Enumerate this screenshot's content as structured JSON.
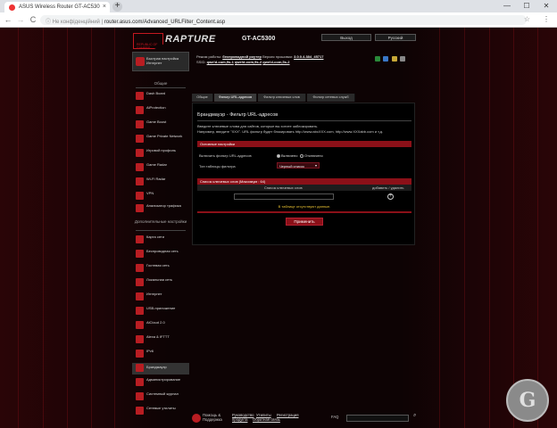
{
  "browser": {
    "tab_title": "ASUS Wireless Router GT-AC530",
    "tab_close": "×",
    "new_tab": "+",
    "win_minimize": "—",
    "win_maximize": "☐",
    "win_close": "✕",
    "back": "←",
    "forward": "→",
    "reload": "C",
    "security_label": "ⓘ Не конфіденційний",
    "separator": "|",
    "url": "router.asus.com/Advanced_URLFilter_Content.asp"
  },
  "header": {
    "brand": "RAPTURE",
    "rog_text": "REPUBLIC OF GAMERS",
    "model": "GT-AC5300",
    "logout": "Выход",
    "language": "Русский"
  },
  "sysinfo": {
    "mode_label": "Режим работы:",
    "mode_value": "беспроводной роутер",
    "fw_label": "Версия прошивки:",
    "fw_value": "3.0.0.4.384_45717",
    "ssid_label": "SSID:",
    "ssid1": "qwe!d-com,5s-1",
    "ssid2": "qwe!d-com,5s-2",
    "ssid3": "qwe!d-com,5s-2"
  },
  "sidebar": {
    "qis_label": "Быстрая настройка Интернет",
    "general_title": "Общие",
    "advanced_title": "Дополнительные настройки",
    "general_items": [
      {
        "label": "Dash Board"
      },
      {
        "label": "AiProtection"
      },
      {
        "label": "Game Boost"
      },
      {
        "label": "Game Private Network"
      },
      {
        "label": "Игровой профиль"
      },
      {
        "label": "Game Radar"
      },
      {
        "label": "Wi-Fi Radar"
      },
      {
        "label": "VPN"
      },
      {
        "label": "Анализатор трафика"
      }
    ],
    "advanced_items": [
      {
        "label": "Карта сети"
      },
      {
        "label": "Беспроводная сеть"
      },
      {
        "label": "Гостевая сеть"
      },
      {
        "label": "Локальная сеть"
      },
      {
        "label": "Интернет"
      },
      {
        "label": "USB-приложение"
      },
      {
        "label": "AiCloud 2.0"
      },
      {
        "label": "Alexa & IFTTT"
      },
      {
        "label": "IPv6"
      },
      {
        "label": "Брандмауэр"
      },
      {
        "label": "Администрирование"
      },
      {
        "label": "Системный журнал"
      },
      {
        "label": "Сетевые утилиты"
      }
    ]
  },
  "tabs": [
    {
      "label": "Общие"
    },
    {
      "label": "Фильтр URL-адресов"
    },
    {
      "label": "Фильтр ключевых слов"
    },
    {
      "label": "Фильтр сетевых служб"
    }
  ],
  "panel": {
    "title": "Брандмауэр - Фильтр URL-адресов",
    "desc1": "Введите ключевые слова для сайтов, которые вы хотите заблокировать.",
    "desc2": "Например, введите \"XXX\". URL фильтр будет блокировать http://www.abcXXX.com, http://www.XXXabb.com и т.д.",
    "basic_settings": "Основные настройки",
    "enable_label": "Включить фильтр URL-адресов",
    "enable_on": "Включено",
    "enable_off": "Отключено",
    "type_label": "Тип таблицы фильтра",
    "type_value": "Черный список",
    "type_arrow": "▾",
    "list_header": "Список ключевых слов (Максимум : 64)",
    "col_keyword": "Список ключевых слов",
    "col_action": "добавить / удалить",
    "add_symbol": "+",
    "no_data": "В таблице отсутствуют данные.",
    "apply": "Применить"
  },
  "footer": {
    "help_label": "Помощь & Поддержка",
    "manual": "Руководство",
    "utility": "Утилиты",
    "registration": "Регистрация",
    "download": "продукта",
    "feedback": "Обратная связь",
    "faq": "FAQ",
    "search_icon": "⌕"
  },
  "watermark": "G",
  "colors": {
    "accent": "#8b1018",
    "brand_red": "#c41820",
    "background": "#0d0304",
    "warning_text": "#e8c032"
  },
  "icons": {
    "qis": "rocket-icon",
    "status": [
      "globe-icon",
      "usb-icon",
      "wifi-icon",
      "gear-icon"
    ]
  }
}
